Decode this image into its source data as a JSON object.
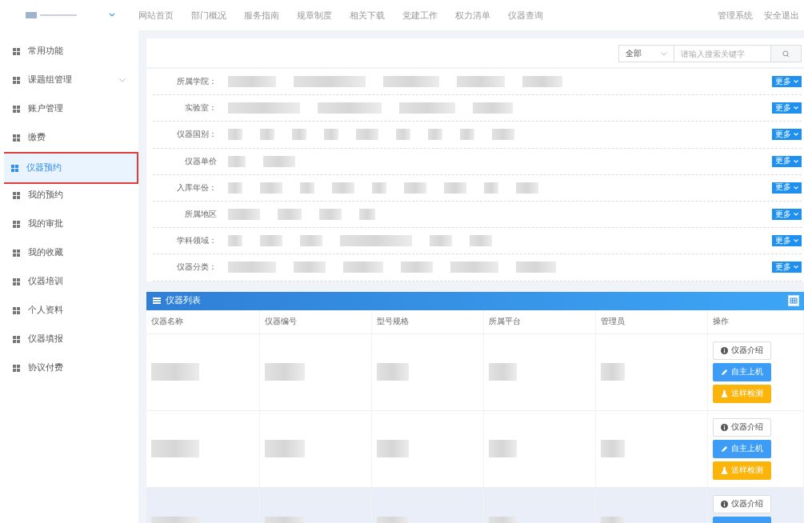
{
  "top_nav": {
    "items": [
      "网站首页",
      "部门概况",
      "服务指南",
      "规章制度",
      "相关下载",
      "党建工作",
      "权力清单",
      "仪器查询"
    ],
    "right_links": [
      "管理系统",
      "安全退出"
    ]
  },
  "sidebar": {
    "items": [
      {
        "label": "常用功能",
        "selected": false,
        "expandable": false
      },
      {
        "label": "课题组管理",
        "selected": false,
        "expandable": true
      },
      {
        "label": "账户管理",
        "selected": false,
        "expandable": false
      },
      {
        "label": "缴费",
        "selected": false,
        "expandable": false
      },
      {
        "label": "仪器预约",
        "selected": true,
        "expandable": false
      },
      {
        "label": "我的预约",
        "selected": false,
        "expandable": false
      },
      {
        "label": "我的审批",
        "selected": false,
        "expandable": false
      },
      {
        "label": "我的收藏",
        "selected": false,
        "expandable": false
      },
      {
        "label": "仪器培训",
        "selected": false,
        "expandable": false
      },
      {
        "label": "个人资料",
        "selected": false,
        "expandable": false
      },
      {
        "label": "仪器填报",
        "selected": false,
        "expandable": false
      },
      {
        "label": "协议付费",
        "selected": false,
        "expandable": false
      }
    ]
  },
  "search": {
    "scope": "全部",
    "placeholder": "请输入搜索关键字"
  },
  "filters": [
    {
      "label": "所属学院：",
      "more": "更多"
    },
    {
      "label": "实验室：",
      "more": "更多"
    },
    {
      "label": "仪器国别：",
      "more": "更多"
    },
    {
      "label": "仪器单价",
      "more": "更多"
    },
    {
      "label": "入库年份：",
      "more": "更多"
    },
    {
      "label": "所属地区",
      "more": "更多"
    },
    {
      "label": "学科领域：",
      "more": "更多"
    },
    {
      "label": "仪器分类：",
      "more": "更多"
    }
  ],
  "table": {
    "title": "仪器列表",
    "columns": [
      "仪器名称",
      "仪器编号",
      "型号规格",
      "所属平台",
      "管理员",
      "操作"
    ],
    "rows": [
      {
        "highlighted": false,
        "actions": [
          {
            "kind": "info",
            "label": "仪器介绍"
          },
          {
            "kind": "self",
            "label": "自主上机"
          },
          {
            "kind": "sample",
            "label": "送样检测"
          }
        ]
      },
      {
        "highlighted": false,
        "actions": [
          {
            "kind": "info",
            "label": "仪器介绍"
          },
          {
            "kind": "self",
            "label": "自主上机"
          },
          {
            "kind": "sample",
            "label": "送样检测"
          }
        ]
      },
      {
        "highlighted": true,
        "actions": [
          {
            "kind": "info",
            "label": "仪器介绍"
          },
          {
            "kind": "self"
          }
        ]
      }
    ]
  }
}
